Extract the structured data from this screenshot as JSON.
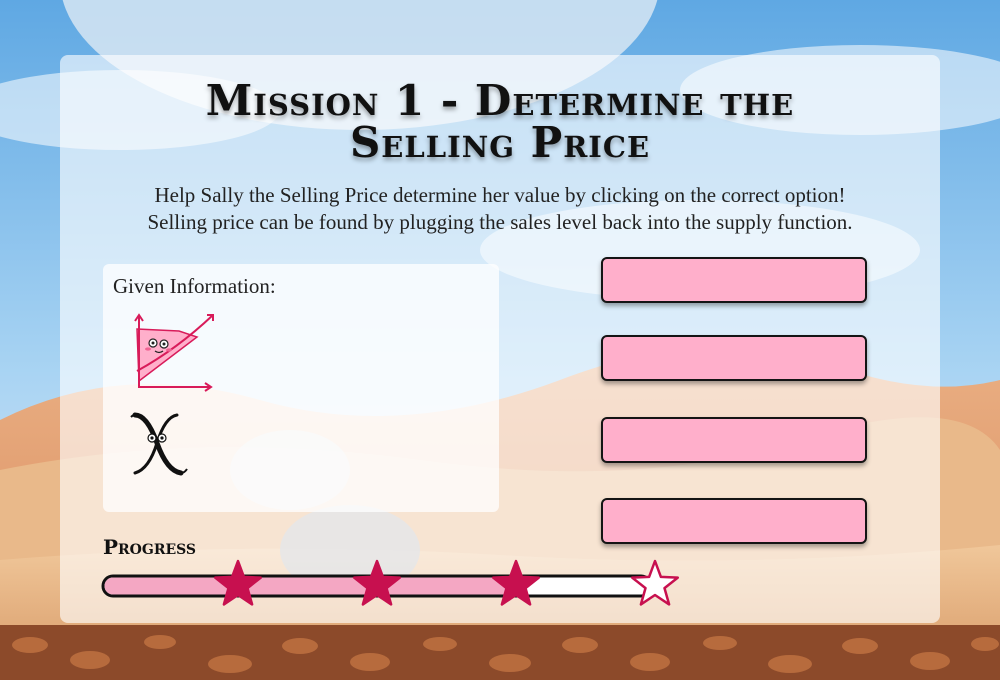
{
  "mission": {
    "title_lines": [
      "Mission 1 - Determine the",
      "Selling Price"
    ]
  },
  "instructions": [
    "Help Sally the Selling Price determine her value by clicking on the correct option!",
    "Selling price can be found by plugging the sales level back into the supply function."
  ],
  "given": {
    "label": "Given Information:",
    "items": [
      {
        "icon": "supply-function-character-icon"
      },
      {
        "icon": "x-variable-character-icon"
      }
    ]
  },
  "answers": [
    {
      "label": ""
    },
    {
      "label": ""
    },
    {
      "label": ""
    },
    {
      "label": ""
    }
  ],
  "progress": {
    "label": "Progress",
    "fraction": 0.75,
    "stars_total": 4,
    "stars_earned": 3
  },
  "colors": {
    "accent_pink": "#ffafcb",
    "star_crimson": "#c7104f",
    "progress_fill": "#f4a7c3",
    "sky": "#8ec3ea",
    "sand": "#e6a878"
  }
}
